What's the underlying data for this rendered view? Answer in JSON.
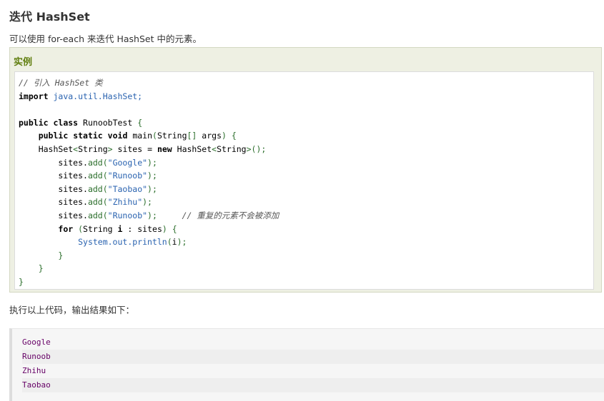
{
  "heading": "迭代 HashSet",
  "intro": "可以使用 for-each 来迭代 HashSet 中的元素。",
  "example": {
    "title": "实例",
    "code": {
      "l1_comment": "// 引入 HashSet 类",
      "l2_import": "import",
      "l2_pkg": "java.util.HashSet;",
      "l4_public": "public",
      "l4_class": "class",
      "l4_name": "RunoobTest",
      "l5_public": "public",
      "l5_static": "static",
      "l5_void": "void",
      "l5_main": "main",
      "l5_type": "String",
      "l5_args": "args",
      "l6_type": "HashSet",
      "l6_gen": "String",
      "l6_var": "sites",
      "l6_new": "new",
      "l6_type2": "HashSet",
      "l6_gen2": "String",
      "adds": [
        "\"Google\"",
        "\"Runoob\"",
        "\"Taobao\"",
        "\"Zhihu\"",
        "\"Runoob\""
      ],
      "dup_comment": "// 重复的元素不会被添加",
      "for_kw": "for",
      "for_type": "String",
      "for_var": "i",
      "for_coll": "sites",
      "print_call": "System.out.println",
      "print_arg": "i"
    }
  },
  "exec_text": "执行以上代码，输出结果如下：",
  "output_lines": [
    "Google",
    "Runoob",
    "Zhihu",
    "Taobao"
  ]
}
